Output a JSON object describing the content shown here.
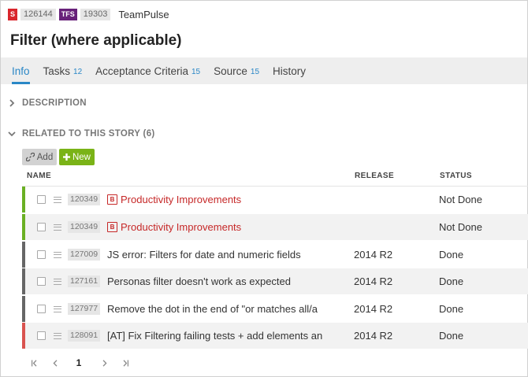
{
  "header": {
    "s_tag": "S",
    "story_id": "126144",
    "tfs_tag": "TFS",
    "tfs_id": "19303",
    "project": "TeamPulse",
    "title": "Filter (where applicable)"
  },
  "tabs": [
    {
      "label": "Info",
      "count": ""
    },
    {
      "label": "Tasks",
      "count": "12"
    },
    {
      "label": "Acceptance Criteria",
      "count": "15"
    },
    {
      "label": "Source",
      "count": "15"
    },
    {
      "label": "History",
      "count": ""
    }
  ],
  "sections": {
    "description": "DESCRIPTION",
    "related": "RELATED TO THIS STORY (6)"
  },
  "toolbar": {
    "add_label": "Add",
    "new_label": "New"
  },
  "table": {
    "columns": {
      "name": "NAME",
      "release": "RELEASE",
      "status": "STATUS"
    },
    "rows": [
      {
        "id": "120349",
        "name": "Productivity Improvements",
        "type": "bug",
        "release": "",
        "status": "Not Done",
        "color": "#6ab023"
      },
      {
        "id": "120349",
        "name": "Productivity Improvements",
        "type": "bug",
        "release": "",
        "status": "Not Done",
        "color": "#6ab023"
      },
      {
        "id": "127009",
        "name": "JS error: Filters for date and numeric fields",
        "type": "story",
        "release": "2014 R2",
        "status": "Done",
        "color": "#666666"
      },
      {
        "id": "127161",
        "name": "Personas filter doesn't work as expected",
        "type": "story",
        "release": "2014 R2",
        "status": "Done",
        "color": "#666666"
      },
      {
        "id": "127977",
        "name": "Remove the dot in the end of \"or matches all/a",
        "type": "story",
        "release": "2014 R2",
        "status": "Done",
        "color": "#666666"
      },
      {
        "id": "128091",
        "name": "[AT] Fix Filtering failing tests + add elements an",
        "type": "story",
        "release": "2014 R2",
        "status": "Done",
        "color": "#d9534f"
      }
    ]
  },
  "pager": {
    "first": "|<",
    "prev": "<",
    "page": "1",
    "next": ">",
    "last": ">|"
  },
  "colors": {
    "accent": "#2a87c6",
    "new_button": "#7ab317",
    "bug_text": "#c62828"
  }
}
